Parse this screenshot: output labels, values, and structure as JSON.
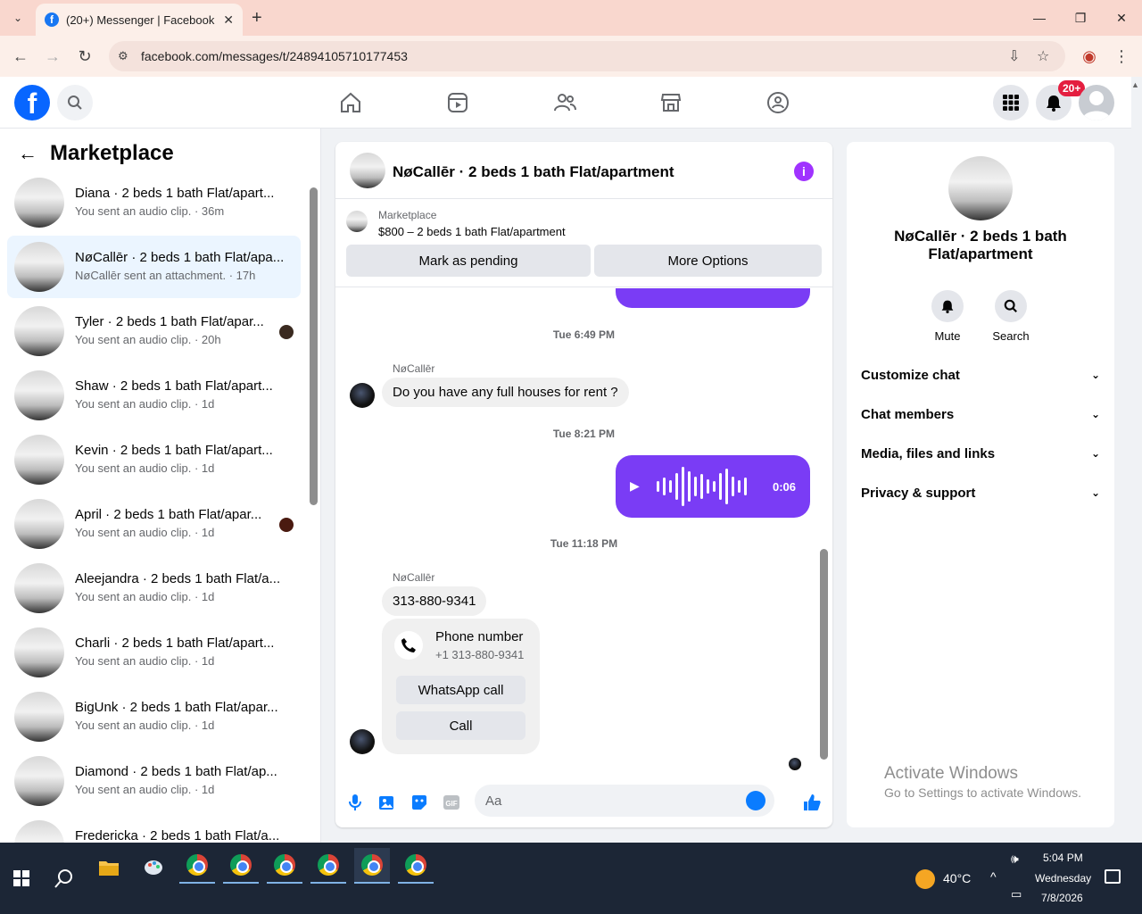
{
  "browser": {
    "tab_title": "(20+) Messenger | Facebook",
    "url": "facebook.com/messages/t/24894105710177453"
  },
  "header": {
    "notification_badge": "20+"
  },
  "sidebar": {
    "title": "Marketplace",
    "conversations": [
      {
        "name": "Diana · 2 beds 1 bath Flat/apart...",
        "sub": "You sent an audio clip. · 36m"
      },
      {
        "name": "NøCallēr · 2 beds 1 bath Flat/apa...",
        "sub": "NøCallēr sent an attachment. · 17h"
      },
      {
        "name": "Tyler · 2 beds 1 bath Flat/apar...",
        "sub": "You sent an audio clip. · 20h"
      },
      {
        "name": "Shaw · 2 beds 1 bath Flat/apart...",
        "sub": "You sent an audio clip. · 1d"
      },
      {
        "name": "Kevin · 2 beds 1 bath Flat/apart...",
        "sub": "You sent an audio clip. · 1d"
      },
      {
        "name": "April · 2 beds 1 bath Flat/apar...",
        "sub": "You sent an audio clip. · 1d"
      },
      {
        "name": "Aleejandra · 2 beds 1 bath Flat/a...",
        "sub": "You sent an audio clip. · 1d"
      },
      {
        "name": "Charli · 2 beds 1 bath Flat/apart...",
        "sub": "You sent an audio clip. · 1d"
      },
      {
        "name": "BigUnk · 2 beds 1 bath Flat/apar...",
        "sub": "You sent an audio clip. · 1d"
      },
      {
        "name": "Diamond · 2 beds 1 bath Flat/ap...",
        "sub": "You sent an audio clip. · 1d"
      },
      {
        "name": "Fredericka · 2 beds 1 bath Flat/a...",
        "sub": ""
      }
    ]
  },
  "chat": {
    "title": "NøCallēr · 2 beds 1 bath Flat/apartment",
    "marketplace_label": "Marketplace",
    "listing": "$800 – 2 beds 1 bath Flat/apartment",
    "mark_pending": "Mark as pending",
    "more_options": "More Options",
    "time1": "Tue 6:49 PM",
    "sender": "NøCallēr",
    "msg1": "Do you have any full houses for rent ?",
    "time2": "Tue 8:21 PM",
    "audio_duration": "0:06",
    "time3": "Tue 11:18 PM",
    "msg2": "313-880-9341",
    "phone_card_title": "Phone number",
    "phone_card_number": "+1 313-880-9341",
    "whatsapp_call": "WhatsApp call",
    "call": "Call",
    "composer_placeholder": "Aa"
  },
  "details": {
    "name": "NøCallēr · 2 beds 1 bath Flat/apartment",
    "mute": "Mute",
    "search": "Search",
    "sections": [
      "Customize chat",
      "Chat members",
      "Media, files and links",
      "Privacy & support"
    ]
  },
  "watermark": {
    "line1": "Activate Windows",
    "line2": "Go to Settings to activate Windows."
  },
  "taskbar": {
    "temperature": "40°C",
    "time": "5:04 PM",
    "day": "Wednesday",
    "date": "7/8/2026"
  }
}
